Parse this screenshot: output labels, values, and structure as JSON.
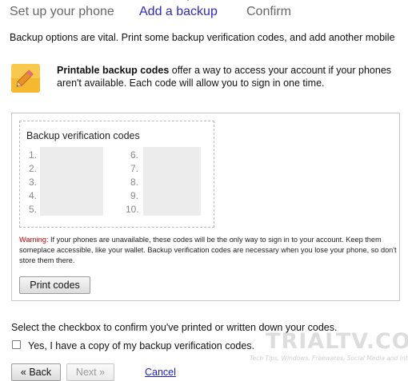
{
  "steps": {
    "items": [
      {
        "label": "Set up your phone"
      },
      {
        "label": "Add a backup"
      },
      {
        "label": "Confirm"
      }
    ],
    "active_index": 1
  },
  "intro": "Backup options are vital. Print some backup verification codes, and add another mobile",
  "lead": {
    "bold": "Printable backup codes",
    "rest": " offer a way to access your account if your phones aren't available. Each code will allow you to sign in one time."
  },
  "codes": {
    "title": "Backup verification codes",
    "left_numbers": [
      "1.",
      "2.",
      "3.",
      "4.",
      "5."
    ],
    "right_numbers": [
      "6.",
      "7.",
      "8.",
      "9.",
      "10."
    ]
  },
  "warning": {
    "label": "Warning:",
    "text": " If your phones are unavailable, these codes will be the only way to sign in to your account. Keep them someplace accessible, like your wallet. Backup verification codes are necessary when you lose your phone, so don't store them there."
  },
  "print_button": "Print codes",
  "confirm": {
    "instruction": "Select the checkbox to confirm you've printed or written down your codes.",
    "checkbox_label": "Yes, I have a copy of my backup verification codes.",
    "checked": false
  },
  "nav": {
    "back": "« Back",
    "next": "Next »",
    "cancel": "Cancel"
  },
  "watermark": {
    "title": "TRIALTV.COM",
    "subtitle": "Tech Tips, Windows, Freewares, Social Media and Internet"
  },
  "icons": {
    "pencil": "pencil-icon"
  },
  "colors": {
    "active_step": "#2a2acc",
    "warning": "#cc0000",
    "link": "#1a1ad6",
    "pencil_bg": "#f5b82e"
  }
}
